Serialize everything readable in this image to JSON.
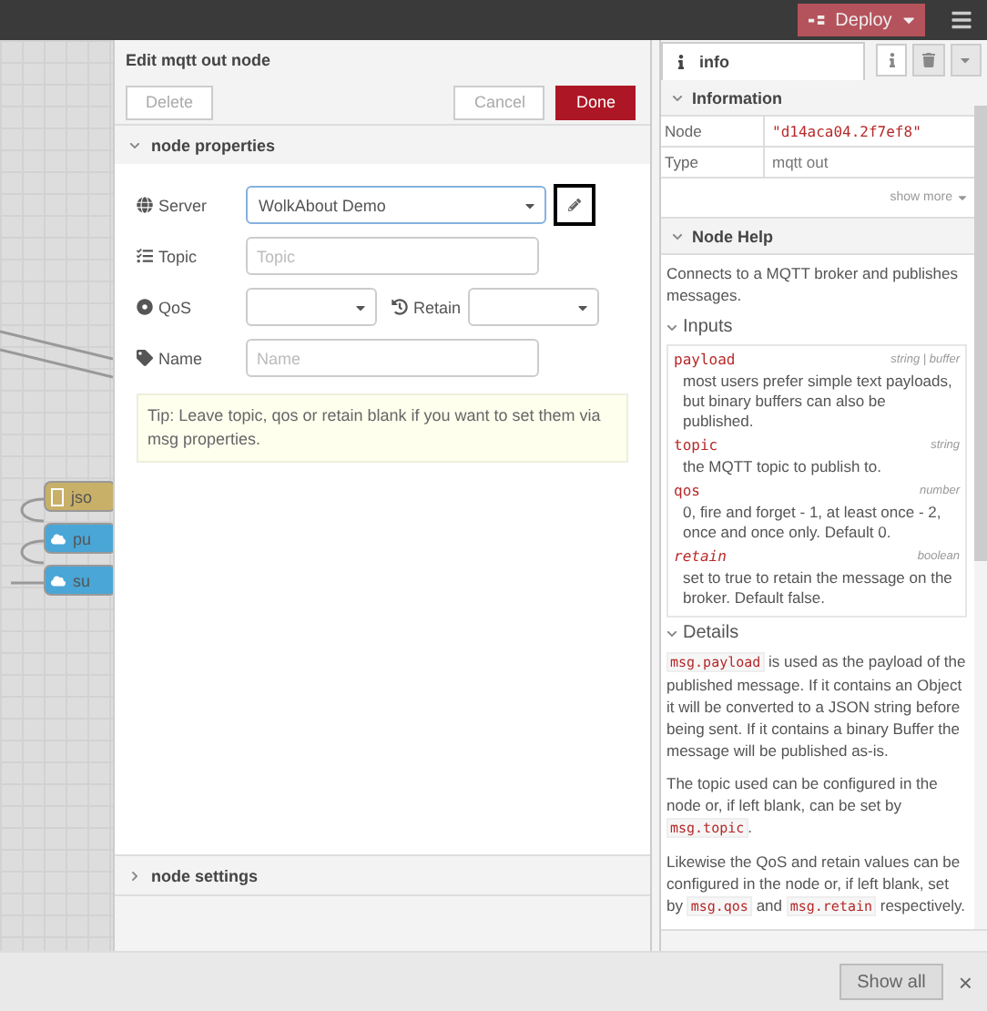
{
  "header": {
    "deploy": "Deploy"
  },
  "canvas": {
    "nodes": [
      {
        "label": "jso",
        "kind": "function"
      },
      {
        "label": "pu",
        "kind": "mqtt"
      },
      {
        "label": "su",
        "kind": "mqtt"
      }
    ]
  },
  "editor": {
    "title": "Edit mqtt out node",
    "buttons": {
      "delete": "Delete",
      "cancel": "Cancel",
      "done": "Done"
    },
    "properties": {
      "title": "node properties",
      "expanded": true
    },
    "server": {
      "label": "Server",
      "value": "WolkAbout Demo"
    },
    "topic": {
      "label": "Topic",
      "placeholder": "Topic"
    },
    "qos": {
      "label": "QoS"
    },
    "retain": {
      "label": "Retain"
    },
    "name": {
      "label": "Name",
      "placeholder": "Name"
    },
    "tip": "Tip: Leave topic, qos or retain blank if you want to set them via msg properties.",
    "settings": {
      "title": "node settings",
      "expanded": false
    }
  },
  "sidebar": {
    "tabs": [
      {
        "label": "info",
        "selected": true
      }
    ],
    "information": {
      "title": "Information",
      "expanded": true,
      "rows": [
        {
          "label": "Node",
          "value": "\"d14aca04.2f7ef8\"",
          "kind": "id"
        },
        {
          "label": "Type",
          "value": "mqtt out",
          "kind": "text"
        }
      ],
      "show_more": "show more"
    },
    "help": {
      "title": "Node Help",
      "expanded": true,
      "intro": "Connects to a MQTT broker and publishes messages.",
      "inputs": {
        "title": "Inputs",
        "expanded": true,
        "items": [
          {
            "name": "payload",
            "type": "string | buffer",
            "description": "most users prefer simple text payloads, but binary buffers can also be published."
          },
          {
            "name": "topic",
            "type": "string",
            "description": "the MQTT topic to publish to."
          },
          {
            "name": "qos",
            "type": "number",
            "description": "0, fire and forget - 1, at least once - 2, once and once only. Default 0."
          },
          {
            "name": "retain",
            "type": "boolean",
            "description": "set to true to retain the message on the broker. Default false."
          }
        ]
      },
      "details": {
        "title": "Details",
        "expanded": true,
        "paragraphs": [
          [
            {
              "kind": "code",
              "text": "msg.payload"
            },
            {
              "kind": "text",
              "text": " is used as the payload of the published message. If it contains an Object it will be converted to a JSON string before being sent. If it contains a binary Buffer the message will be published as-is."
            }
          ],
          [
            {
              "kind": "text",
              "text": "The topic used can be configured in the node or, if left blank, can be set by "
            },
            {
              "kind": "code",
              "text": "msg.topic"
            },
            {
              "kind": "text",
              "text": "."
            }
          ],
          [
            {
              "kind": "text",
              "text": "Likewise the QoS and retain values can be configured in the node or, if left blank, set by "
            },
            {
              "kind": "code",
              "text": "msg.qos"
            },
            {
              "kind": "text",
              "text": " and "
            },
            {
              "kind": "code",
              "text": "msg.retain"
            },
            {
              "kind": "text",
              "text": " respectively."
            }
          ]
        ]
      }
    }
  },
  "footer": {
    "show_all": "Show all",
    "close": "×"
  }
}
